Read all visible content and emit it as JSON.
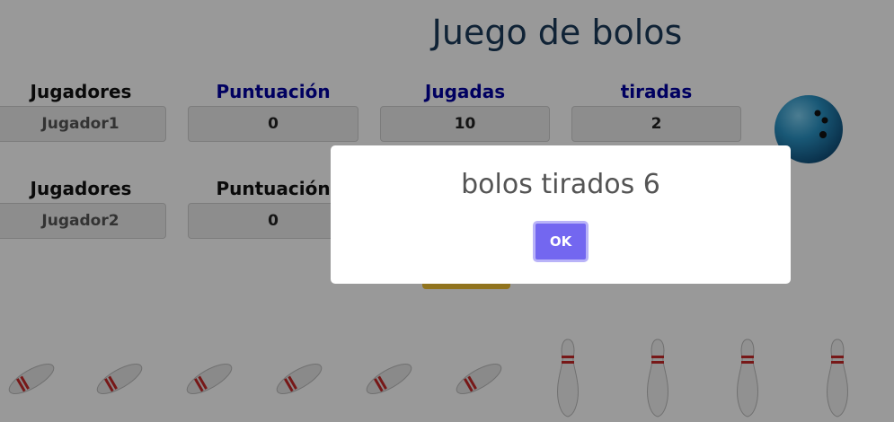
{
  "app": {
    "title": "Juego de bolos"
  },
  "player_rows": [
    {
      "headers": [
        "Jugadores",
        "Puntuación",
        "Jugadas",
        "tiradas"
      ],
      "player_name": "Jugador1",
      "score": "0",
      "plays": "10",
      "throws": "2"
    },
    {
      "headers": [
        "Jugadores",
        "Puntuación"
      ],
      "player_name": "Jugador2",
      "score": "0"
    }
  ],
  "icons": {
    "ball": "bowling-ball-icon",
    "pin": "bowling-pin-icon"
  },
  "pins": {
    "knocked_down": 6,
    "standing": 4
  },
  "dialog": {
    "message": "bolos tirados 6",
    "ok_label": "OK"
  },
  "colors": {
    "accent": "#7367f0",
    "header_blue": "#0000a0",
    "title": "#1b3b5a",
    "gold_button": "#f2c232"
  }
}
